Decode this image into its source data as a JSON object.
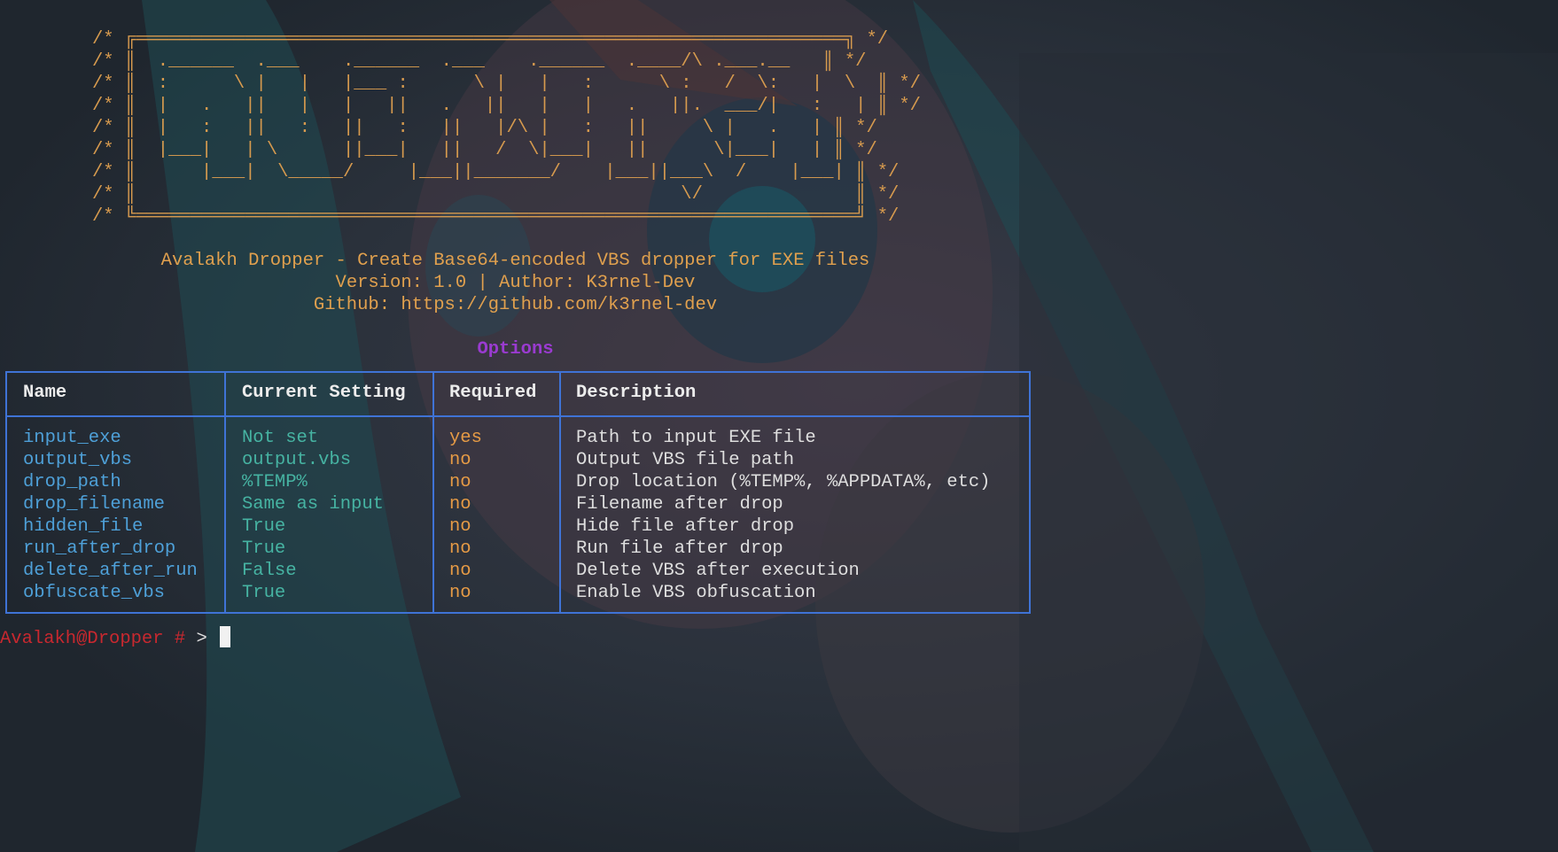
{
  "banner": {
    "ascii_lines": [
      "/* ╔═════════════════════════════════════════════════════════════════╗ */",
      "/* ║  .______  .___    .______  .___    .______  .____/\\ .___.__   ║ */",
      "/* ║  :      \\ |   |   |___ :      \\ |   |   :      \\ :   /  \\:   |  \\  ║ */",
      "/* ║  |   .   ||   |   |   ||   .   ||   |   |   .   ||.  ___/|   :   | ║ */",
      "/* ║  |   :   ||   :   ||   :   ||   |/\\ |   :   ||     \\ |   .   | ║ */",
      "/* ║  |___|   | \\      ||___|   ||   /  \\|___|   ||      \\|___|   | ║ */",
      "/* ║      |___|  \\_____/     |___||_______/    |___||___\\  /    |___| ║ */",
      "/* ║                                                  \\/              ║ */",
      "/* ╚══════════════════════════════════════════════════════════════════╝ */"
    ],
    "description": "Avalakh Dropper - Create Base64-encoded VBS dropper for EXE files",
    "version_line": "Version: 1.0 | Author: K3rnel-Dev",
    "github_line": "Github: https://github.com/k3rnel-dev"
  },
  "options": {
    "title": "Options",
    "headers": {
      "name": "Name",
      "setting": "Current Setting",
      "required": "Required",
      "description": "Description"
    },
    "rows": [
      {
        "name": "input_exe",
        "setting": "Not set",
        "required": "yes",
        "description": "Path to input EXE file"
      },
      {
        "name": "output_vbs",
        "setting": "output.vbs",
        "required": "no",
        "description": "Output VBS file path"
      },
      {
        "name": "drop_path",
        "setting": "%TEMP%",
        "required": "no",
        "description": "Drop location (%TEMP%, %APPDATA%, etc)"
      },
      {
        "name": "drop_filename",
        "setting": "Same as input",
        "required": "no",
        "description": "Filename after drop"
      },
      {
        "name": "hidden_file",
        "setting": "True",
        "required": "no",
        "description": "Hide file after drop"
      },
      {
        "name": "run_after_drop",
        "setting": "True",
        "required": "no",
        "description": "Run file after drop"
      },
      {
        "name": "delete_after_run",
        "setting": "False",
        "required": "no",
        "description": "Delete VBS after execution"
      },
      {
        "name": "obfuscate_vbs",
        "setting": "True",
        "required": "no",
        "description": "Enable VBS obfuscation"
      }
    ]
  },
  "prompt": {
    "user": "Avalakh@Dropper",
    "hash": "#",
    "arrow": ">"
  },
  "colors": {
    "banner": "#d69a4e",
    "options_title": "#9a3bd0",
    "table_border": "#3f73d6",
    "name_column": "#4ea0d8",
    "setting_column": "#46b3a2",
    "required_column": "#e59a45",
    "prompt_user": "#c8282f"
  }
}
